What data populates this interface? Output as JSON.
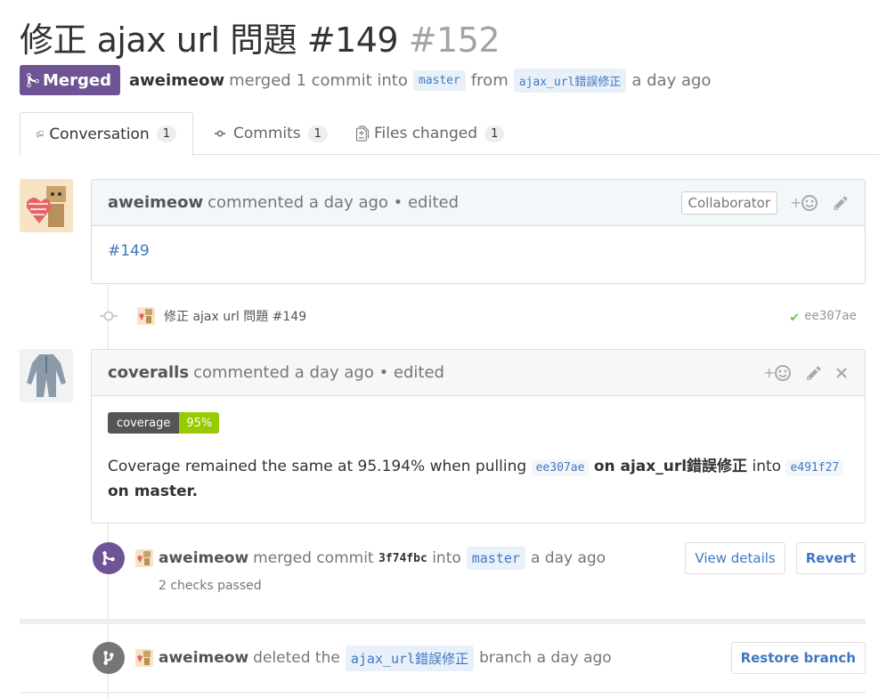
{
  "pr": {
    "title": "修正 ajax url 問題 #149",
    "number": "#152",
    "state": "Merged",
    "author": "aweimeow",
    "merge_text": "merged 1 commit into",
    "base_branch": "master",
    "from_text": "from",
    "head_branch": "ajax_url錯誤修正",
    "time": "a day ago"
  },
  "tabs": [
    {
      "label": "Conversation",
      "count": "1"
    },
    {
      "label": "Commits",
      "count": "1"
    },
    {
      "label": "Files changed",
      "count": "1"
    }
  ],
  "comment1": {
    "author": "aweimeow",
    "meta": "commented a day ago • edited",
    "role": "Collaborator",
    "body_link": "#149"
  },
  "commit": {
    "message": "修正 ajax url 問題  #149",
    "sha": "ee307ae"
  },
  "comment2": {
    "author": "coveralls",
    "meta": "commented a day ago • edited",
    "badge_left": "coverage",
    "badge_right": "95%",
    "text1": "Coverage remained the same at 95.194% when pulling",
    "sha1": "ee307ae",
    "text2": "on ajax_url錯誤修正",
    "text3": "into",
    "sha2": "e491f27",
    "text4": "on master."
  },
  "merge_event": {
    "author": "aweimeow",
    "text": "merged commit",
    "sha": "3f74fbc",
    "into": "into",
    "branch": "master",
    "time": "a day ago",
    "checks": "2 checks passed",
    "view_details": "View details",
    "revert": "Revert"
  },
  "delete_event": {
    "author": "aweimeow",
    "text": "deleted the",
    "branch": "ajax_url錯誤修正",
    "time": "branch a day ago",
    "restore": "Restore branch"
  },
  "colors": {
    "merged": "#6e5494",
    "link": "#4078c0",
    "badge_ok": "#97ca00",
    "check": "#6cc644"
  }
}
